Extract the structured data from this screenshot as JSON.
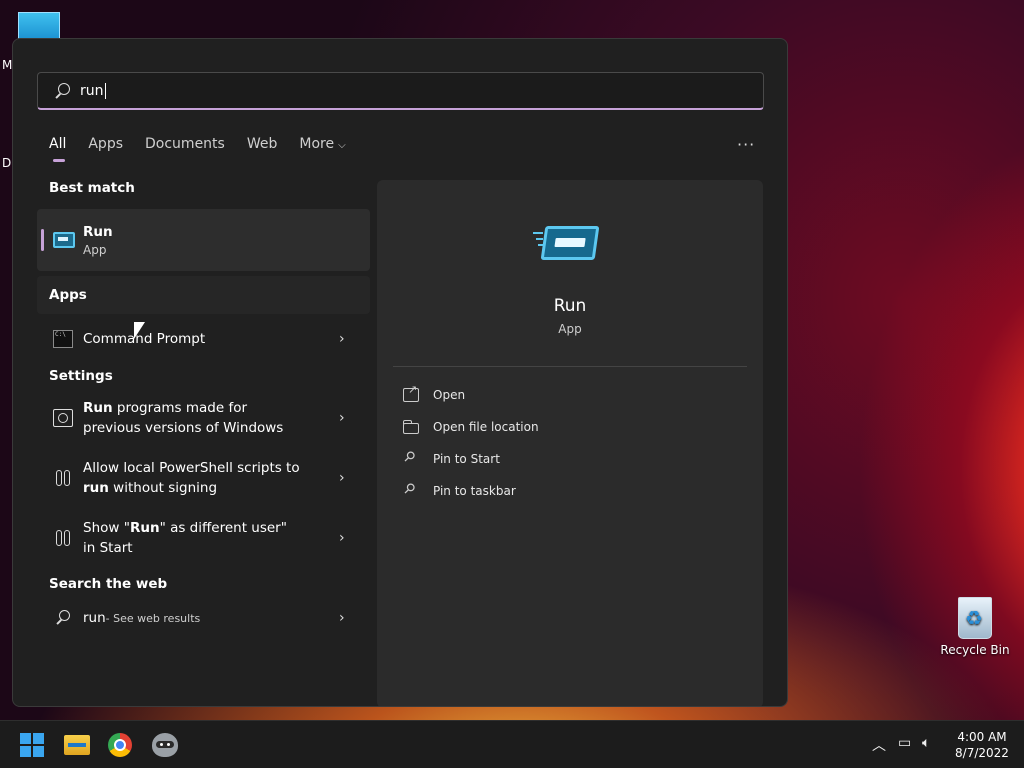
{
  "desktop": {
    "letters": [
      "M",
      "Da"
    ],
    "recycle_bin_label": "Recycle Bin"
  },
  "search": {
    "value": "run",
    "icon": "search-icon"
  },
  "tabs": [
    {
      "label": "All",
      "active": true
    },
    {
      "label": "Apps"
    },
    {
      "label": "Documents"
    },
    {
      "label": "Web"
    },
    {
      "label": "More"
    }
  ],
  "more_options_label": "···",
  "best_match": {
    "section": "Best match",
    "title": "Run",
    "subtitle": "App"
  },
  "apps": {
    "section": "Apps",
    "items": [
      {
        "label": "Command Prompt",
        "icon": "command-prompt-icon"
      }
    ]
  },
  "settings": {
    "section": "Settings",
    "items": [
      {
        "bold": "Run",
        "rest": " programs made for previous versions of Windows"
      },
      {
        "pre": "Allow local PowerShell scripts to ",
        "bold": "run",
        "rest": " without signing"
      },
      {
        "pre": "Show \"",
        "bold": "Run",
        "rest": "\" as different user\" in Start"
      }
    ]
  },
  "web": {
    "section": "Search the web",
    "query": "run",
    "suffix": " - See web results"
  },
  "detail": {
    "title": "Run",
    "subtitle": "App",
    "actions": [
      {
        "label": "Open",
        "icon": "open-icon"
      },
      {
        "label": "Open file location",
        "icon": "folder-icon"
      },
      {
        "label": "Pin to Start",
        "icon": "pin-icon"
      },
      {
        "label": "Pin to taskbar",
        "icon": "pin-icon"
      }
    ]
  },
  "taskbar": {
    "apps": [
      "start-button",
      "file-explorer",
      "chrome",
      "raccoon-app"
    ],
    "time": "4:00 AM",
    "date": "8/7/2022"
  },
  "colors": {
    "accent": "#c7a2d8",
    "panel": "#202020",
    "detail_panel": "#2b2b2b",
    "taskbar": "#1c1c1c"
  }
}
